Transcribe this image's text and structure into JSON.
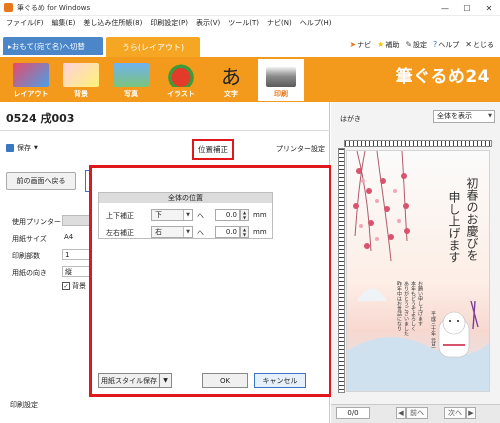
{
  "window": {
    "title": "筆ぐるめ for Windows",
    "minimize": "—",
    "maximize": "☐",
    "close": "✕"
  },
  "menu": [
    "ファイル(F)",
    "編集(E)",
    "差し込み住所帳(8)",
    "印刷設定(P)",
    "表示(V)",
    "ツール(T)",
    "ナビ(N)",
    "ヘルプ(H)"
  ],
  "tabs": {
    "omote_label": "▸おもて(宛て名)へ切替",
    "ura_label": "うら(レイアウト)"
  },
  "top_links": {
    "navi": "ナビ",
    "hojo": "補助",
    "settei": "設定",
    "help": "ヘルプ",
    "close": "とじる"
  },
  "toolbar": {
    "items": [
      "レイアウト",
      "背景",
      "写真",
      "イラスト",
      "文字",
      "印刷"
    ],
    "active": "印刷",
    "logo": "筆ぐるめ24",
    "colors": {
      "bar": "#f39a1d",
      "active_bg": "#ffffff"
    }
  },
  "left": {
    "doc_id": "0524 戌003",
    "save_label": "保存",
    "position_correction": "位置補正",
    "printer_settings": "プリンター設定",
    "back_button": "前の画面へ戻る",
    "print_settings": {
      "header": "印刷設定",
      "printer_label": "使用プリンター",
      "paper_size_label": "用紙サイズ",
      "paper_size_value": "A4",
      "copies_label": "印刷部数",
      "copies_value": "1",
      "orientation_label": "用紙の向き",
      "orientation_value": "縦",
      "background_check": "背景"
    }
  },
  "dialog": {
    "group_title": "全体の位置",
    "vertical_label": "上下補正",
    "vertical_direction": "下",
    "vertical_value": "0.0",
    "horizontal_label": "左右補正",
    "horizontal_direction": "右",
    "horizontal_value": "0.0",
    "unit": "mm",
    "hat": "へ",
    "paper_style_save": "用紙スタイル保存",
    "ok": "OK",
    "cancel": "キャンセル",
    "highlight_color": "#e0181b"
  },
  "preview": {
    "label": "はがき",
    "view_select": "全体を表示",
    "card_text": [
      "初春のお慶びを",
      "申し上げます"
    ],
    "small_text": [
      "昨年中はお世話になり",
      "ありがとうございました",
      "本年もどうぞよろしく",
      "お願い申し上げます"
    ],
    "date_text": "平成三十年 元旦",
    "page_value": "0/0",
    "prev": "前へ",
    "next": "次へ"
  }
}
